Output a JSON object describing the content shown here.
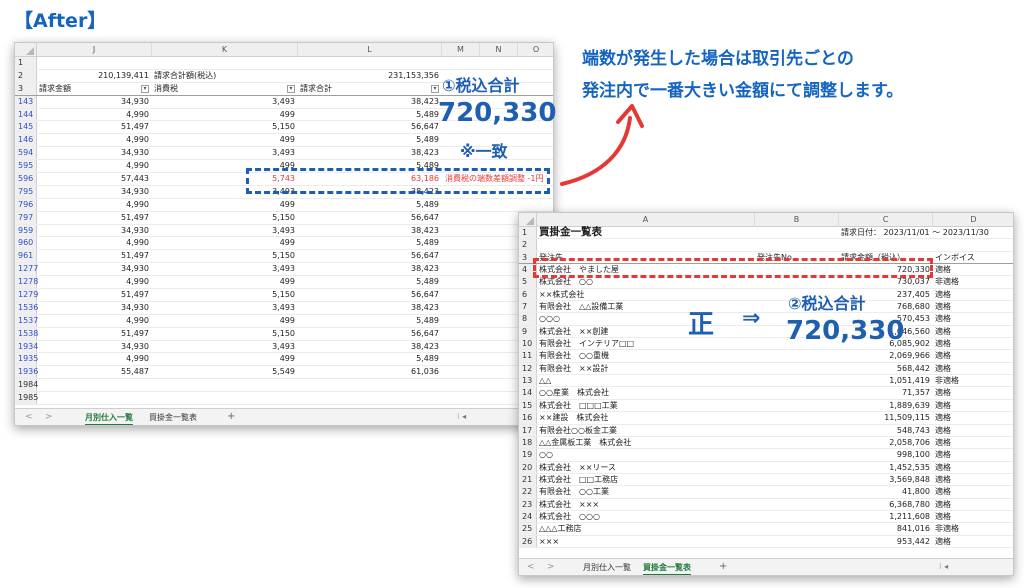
{
  "page_label": "【After】",
  "headline": {
    "line1": "端数が発生した場合は取引先ごとの",
    "line2": "発注内で一番大きい金額にて調整します。"
  },
  "annotations": {
    "tax_total_1_label": "①税込合計",
    "tax_total_1_value": "720,330",
    "match_note": "※一致",
    "correct_label": "正",
    "arrow_symbol": "⇒",
    "tax_total_2_label": "②税込合計",
    "tax_total_2_value": "720,330"
  },
  "colors": {
    "accent_blue": "#1565c0",
    "annotation_red": "#e53935",
    "row_number_blue": "#2f4fd0",
    "active_tab_green": "#1e7a3a"
  },
  "sheet1": {
    "columns": [
      "J",
      "K",
      "L",
      "M",
      "N",
      "O"
    ],
    "header_rows": [
      {
        "rn": "1",
        "j": "",
        "k": "",
        "l": ""
      },
      {
        "rn": "2",
        "j": "210,139,411",
        "k": "請求合計額(税込)",
        "l": "231,153,356"
      },
      {
        "rn": "3",
        "j": "請求金額",
        "k": "消費税",
        "l": "請求合計"
      }
    ],
    "filter_icon": "▾",
    "rows": [
      {
        "rn": "143",
        "j": "34,930",
        "k": "3,493",
        "l": "38,423"
      },
      {
        "rn": "144",
        "j": "4,990",
        "k": "499",
        "l": "5,489"
      },
      {
        "rn": "145",
        "j": "51,497",
        "k": "5,150",
        "l": "56,647"
      },
      {
        "rn": "146",
        "j": "4,990",
        "k": "499",
        "l": "5,489"
      },
      {
        "rn": "594",
        "j": "34,930",
        "k": "3,493",
        "l": "38,423"
      },
      {
        "rn": "595",
        "j": "4,990",
        "k": "499",
        "l": "5,489"
      },
      {
        "rn": "596",
        "j": "57,443",
        "k": "5,743",
        "l": "63,186",
        "note": "消費税の端数差額調整 -1円",
        "highlight": "red"
      },
      {
        "rn": "795",
        "j": "34,930",
        "k": "3,493",
        "l": "38,423"
      },
      {
        "rn": "796",
        "j": "4,990",
        "k": "499",
        "l": "5,489"
      },
      {
        "rn": "797",
        "j": "51,497",
        "k": "5,150",
        "l": "56,647"
      },
      {
        "rn": "959",
        "j": "34,930",
        "k": "3,493",
        "l": "38,423"
      },
      {
        "rn": "960",
        "j": "4,990",
        "k": "499",
        "l": "5,489"
      },
      {
        "rn": "961",
        "j": "51,497",
        "k": "5,150",
        "l": "56,647"
      },
      {
        "rn": "1277",
        "j": "34,930",
        "k": "3,493",
        "l": "38,423"
      },
      {
        "rn": "1278",
        "j": "4,990",
        "k": "499",
        "l": "5,489"
      },
      {
        "rn": "1279",
        "j": "51,497",
        "k": "5,150",
        "l": "56,647"
      },
      {
        "rn": "1536",
        "j": "34,930",
        "k": "3,493",
        "l": "38,423"
      },
      {
        "rn": "1537",
        "j": "4,990",
        "k": "499",
        "l": "5,489"
      },
      {
        "rn": "1538",
        "j": "51,497",
        "k": "5,150",
        "l": "56,647"
      },
      {
        "rn": "1934",
        "j": "34,930",
        "k": "3,493",
        "l": "38,423"
      },
      {
        "rn": "1935",
        "j": "4,990",
        "k": "499",
        "l": "5,489"
      },
      {
        "rn": "1936",
        "j": "55,487",
        "k": "5,549",
        "l": "61,036"
      },
      {
        "rn": "1984",
        "j": "",
        "k": "",
        "l": ""
      },
      {
        "rn": "1985",
        "j": "",
        "k": "",
        "l": ""
      }
    ],
    "tabs": {
      "prev": "<",
      "next": ">",
      "active": "月別仕入一覧",
      "other": "買掛金一覧表",
      "add": "+",
      "scroll": "⁝  ◂"
    }
  },
  "sheet2": {
    "columns": [
      "A",
      "B",
      "C",
      "D"
    ],
    "title": "買掛金一覧表",
    "billing_date": "請求日付：  2023/11/01 ～ 2023/11/30",
    "headers": {
      "a": "発注先",
      "b": "発注先No",
      "c": "請求金額（税込）",
      "d": "インボイス"
    },
    "rows": [
      {
        "rn": "4",
        "a": "株式会社　やました屋",
        "c": "720,330",
        "d": "適格"
      },
      {
        "rn": "5",
        "a": "株式会社　○○",
        "c": "730,037",
        "d": "非適格"
      },
      {
        "rn": "6",
        "a": "××株式会社",
        "c": "237,405",
        "d": "適格"
      },
      {
        "rn": "7",
        "a": "有限会社　△△設備工業",
        "c": "768,680",
        "d": "適格"
      },
      {
        "rn": "8",
        "a": "○○○",
        "c": "570,453",
        "d": "適格"
      },
      {
        "rn": "9",
        "a": "株式会社　××創建",
        "c": "1,046,560",
        "d": "適格"
      },
      {
        "rn": "10",
        "a": "有限会社　インテリア□□",
        "c": "6,085,902",
        "d": "適格"
      },
      {
        "rn": "11",
        "a": "有限会社　○○重機",
        "c": "2,069,966",
        "d": "適格"
      },
      {
        "rn": "12",
        "a": "有限会社　××設計",
        "c": "568,442",
        "d": "適格"
      },
      {
        "rn": "13",
        "a": "△△",
        "c": "1,051,419",
        "d": "非適格"
      },
      {
        "rn": "14",
        "a": "○○産業　株式会社",
        "c": "71,357",
        "d": "適格"
      },
      {
        "rn": "15",
        "a": "株式会社　□□□工業",
        "c": "1,889,639",
        "d": "適格"
      },
      {
        "rn": "16",
        "a": "××建設　株式会社",
        "c": "11,509,115",
        "d": "適格"
      },
      {
        "rn": "17",
        "a": "有限会社○○板金工業",
        "c": "548,743",
        "d": "適格"
      },
      {
        "rn": "18",
        "a": "△△金属板工業　株式会社",
        "c": "2,058,706",
        "d": "適格"
      },
      {
        "rn": "19",
        "a": "○○",
        "c": "998,100",
        "d": "適格"
      },
      {
        "rn": "20",
        "a": "株式会社　××リース",
        "c": "1,452,535",
        "d": "適格"
      },
      {
        "rn": "21",
        "a": "株式会社　□□工務店",
        "c": "3,569,848",
        "d": "適格"
      },
      {
        "rn": "22",
        "a": "有限会社　○○工業",
        "c": "41,800",
        "d": "適格"
      },
      {
        "rn": "23",
        "a": "株式会社　×××",
        "c": "6,368,780",
        "d": "適格"
      },
      {
        "rn": "24",
        "a": "株式会社　○○○",
        "c": "1,211,608",
        "d": "適格"
      },
      {
        "rn": "25",
        "a": "△△△工務店",
        "c": "841,016",
        "d": "非適格"
      },
      {
        "rn": "26",
        "a": "×××",
        "c": "953,442",
        "d": "適格"
      }
    ],
    "tabs": {
      "prev": "<",
      "next": ">",
      "first": "月別仕入一覧",
      "active": "買掛金一覧表",
      "add": "+",
      "scroll": "⁝  ◂"
    }
  }
}
